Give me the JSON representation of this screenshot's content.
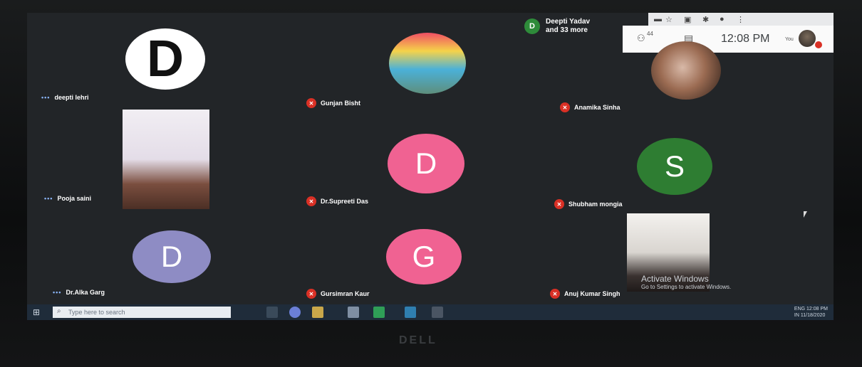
{
  "meeting": {
    "banner_badge": "D",
    "banner_line1": "Deepti Yadav",
    "banner_line2": "and 33 more",
    "people_count": "44",
    "clock": "12:08 PM",
    "you_label": "You"
  },
  "participants": [
    {
      "name": "deepti lehri",
      "avatar_letter": "D",
      "type": "letter",
      "avatar_color": "#ffffff",
      "muted": false
    },
    {
      "name": "Gunjan Bisht",
      "type": "image",
      "muted": true
    },
    {
      "name": "Anamika Sinha",
      "type": "image",
      "muted": true
    },
    {
      "name": "Pooja saini",
      "type": "video",
      "muted": false
    },
    {
      "name": "Dr.Supreeti Das",
      "avatar_letter": "D",
      "type": "letter",
      "avatar_color": "#f06292",
      "muted": true
    },
    {
      "name": "Shubham mongia",
      "avatar_letter": "S",
      "type": "letter",
      "avatar_color": "#2e7d32",
      "muted": true
    },
    {
      "name": "Dr.Alka Garg",
      "avatar_letter": "D",
      "type": "letter",
      "avatar_color": "#8e8cc4",
      "muted": false
    },
    {
      "name": "Gursimran Kaur",
      "avatar_letter": "G",
      "type": "letter",
      "avatar_color": "#f06292",
      "muted": true
    },
    {
      "name": "Anuj Kumar Singh",
      "type": "video",
      "muted": true
    }
  ],
  "windows": {
    "activate_title": "Activate Windows",
    "activate_sub": "Go to Settings to activate Windows.",
    "search_placeholder": "Type here to search",
    "tray_lang1": "ENG",
    "tray_lang2": "IN",
    "tray_time": "12:08 PM",
    "tray_date": "11/18/2020"
  },
  "brand": "DELL",
  "icons": [
    "star-icon",
    "people-icon",
    "chat-icon",
    "mute-icon",
    "windows-start-icon",
    "search-icon"
  ]
}
